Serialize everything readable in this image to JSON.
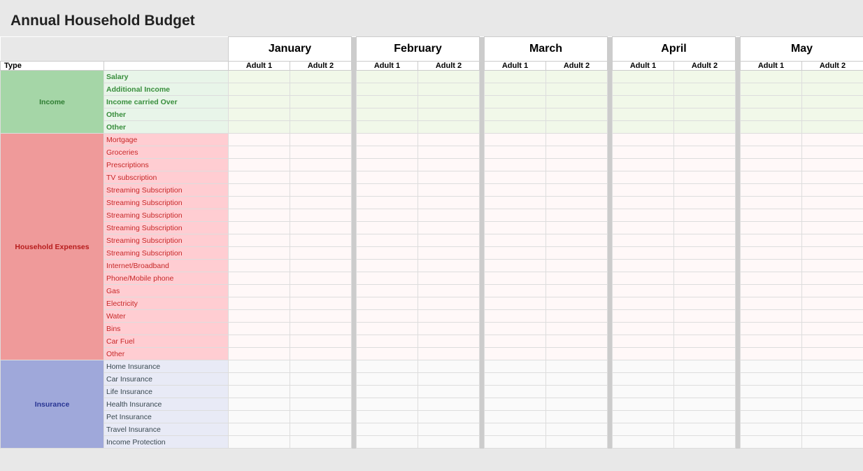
{
  "title": "Annual Household Budget",
  "months": [
    {
      "name": "January",
      "adults": [
        "Adult 1",
        "Adult 2"
      ]
    },
    {
      "name": "February",
      "adults": [
        "Adult 1",
        "Adult 2"
      ]
    },
    {
      "name": "March",
      "adults": [
        "Adult 1",
        "Adult 2"
      ]
    },
    {
      "name": "April",
      "adults": [
        "Adult 1",
        "Adult 2"
      ]
    },
    {
      "name": "May",
      "adults": [
        "Adult 1",
        "Adult 2"
      ]
    }
  ],
  "categories": [
    {
      "name": "Income",
      "type": "income",
      "items": [
        "Salary",
        "Additional Income",
        "Income carried Over",
        "Other",
        "Other"
      ]
    },
    {
      "name": "Household Expenses",
      "type": "household",
      "items": [
        "Mortgage",
        "Groceries",
        "Prescriptions",
        "TV subscription",
        "Streaming Subscription",
        "Streaming Subscription",
        "Streaming Subscription",
        "Streaming Subscription",
        "Streaming Subscription",
        "Streaming Subscription",
        "Internet/Broadband",
        "Phone/Mobile phone",
        "Gas",
        "Electricity",
        "Water",
        "Bins",
        "Car Fuel",
        "Other"
      ]
    },
    {
      "name": "Insurance",
      "type": "insurance",
      "items": [
        "Home Insurance",
        "Car Insurance",
        "Life Insurance",
        "Health Insurance",
        "Pet Insurance",
        "Travel Insurance",
        "Income Protection"
      ]
    }
  ],
  "header": {
    "type_label": "Type"
  }
}
